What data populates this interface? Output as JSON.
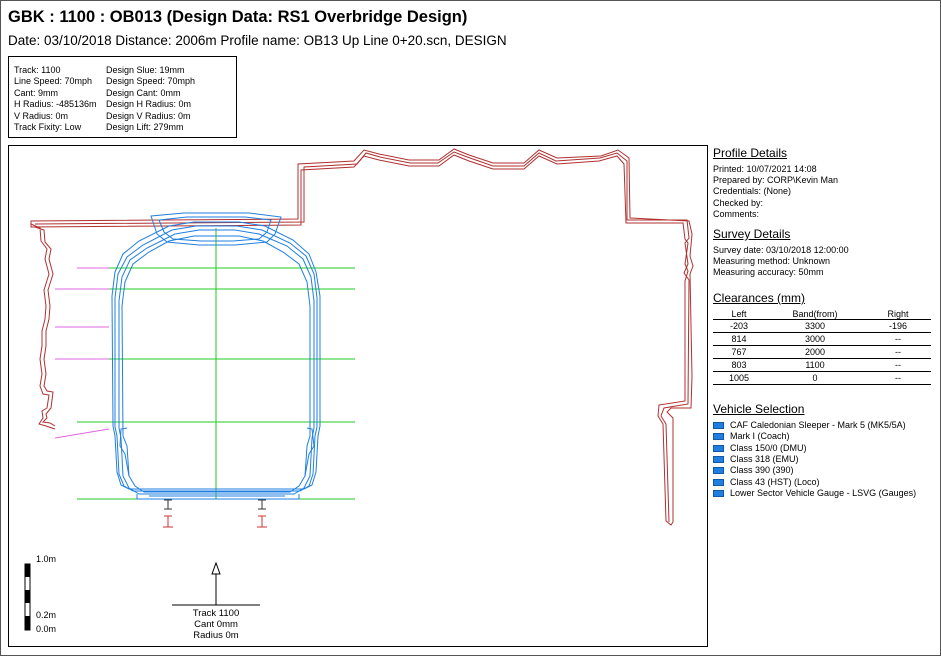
{
  "header": {
    "title": "GBK : 1100 : OB013 (Design Data: RS1 Overbridge Design)",
    "subtitle": "Date: 03/10/2018 Distance: 2006m Profile name: OB13 Up Line 0+20.scn, DESIGN"
  },
  "track_info": {
    "left": [
      "Track: 1100",
      "Line Speed: 70mph",
      "Cant: 9mm",
      "H Radius: -485136m",
      "V Radius: 0m",
      "Track Fixity: Low"
    ],
    "right": [
      "Design Slue: 19mm",
      "Design Speed: 70mph",
      "Design Cant: 0mm",
      "Design H Radius: 0m",
      "Design V Radius: 0m",
      "Design Lift: 279mm"
    ]
  },
  "drawing": {
    "scale_labels": [
      "1.0m",
      "0.2m",
      "0.0m"
    ],
    "track_label": [
      "Track 1100",
      "Cant 0mm",
      "Radius 0m"
    ],
    "colors": {
      "structure": "#b03030",
      "vehicle": "#1f7fe0",
      "band": "#22cc22",
      "clearance": "#e066e0",
      "rail": "#cc3333"
    }
  },
  "profile_details": {
    "heading": "Profile Details",
    "rows": [
      "Printed: 10/07/2021 14:08",
      "Prepared by: CORP\\Kevin Man",
      "Credentials: (None)",
      "Checked by:",
      "Comments:"
    ]
  },
  "survey_details": {
    "heading": "Survey Details",
    "rows": [
      "Survey date: 03/10/2018 12:00:00",
      "Measuring method: Unknown",
      "Measuring accuracy: 50mm"
    ]
  },
  "clearances": {
    "heading": "Clearances (mm)",
    "columns": [
      "Left",
      "Band(from)",
      "Right"
    ],
    "rows": [
      [
        "-203",
        "3300",
        "-196"
      ],
      [
        "814",
        "3000",
        "--"
      ],
      [
        "767",
        "2000",
        "--"
      ],
      [
        "803",
        "1100",
        "--"
      ],
      [
        "1005",
        "0",
        "--"
      ]
    ]
  },
  "vehicle_selection": {
    "heading": "Vehicle Selection",
    "items": [
      "CAF Caledonian Sleeper - Mark 5 (MK5/5A)",
      "Mark I (Coach)",
      "Class 150/0 (DMU)",
      "Class 318 (EMU)",
      "Class 390 (390)",
      "Class 43 (HST) (Loco)",
      "Lower Sector Vehicle Gauge - LSVG (Gauges)"
    ]
  }
}
